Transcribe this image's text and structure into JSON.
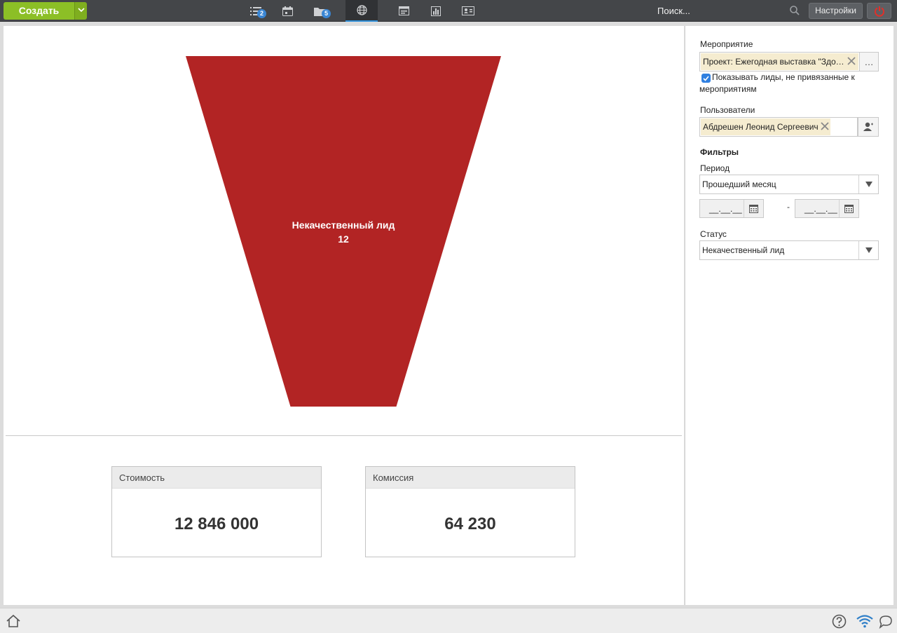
{
  "topbar": {
    "create_label": "Создать",
    "tasks_badge": "2",
    "files_badge": "5",
    "search_placeholder": "Поиск...",
    "settings_label": "Настройки"
  },
  "chart_data": {
    "type": "funnel",
    "stages": [
      {
        "label": "Некачественный лид",
        "value": 12,
        "color": "#b22424"
      }
    ]
  },
  "metrics": [
    {
      "title": "Стоимость",
      "value": "12 846 000"
    },
    {
      "title": "Комиссия",
      "value": "64 230"
    }
  ],
  "filters": {
    "event_label": "Мероприятие",
    "event_value": "Проект: Ежегодная выставка \"Здо…",
    "event_more": "…",
    "show_unlinked_label": "Показывать лиды, не привязанные к мероприятиям",
    "show_unlinked_checked": true,
    "users_label": "Пользователи",
    "users_value": "Абдрешен Леонид Сергеевич",
    "section_title": "Фильтры",
    "period_label": "Период",
    "period_value": "Прошедший месяц",
    "date_from": "__.__.__",
    "date_to": "__.__.__",
    "date_separator": "-",
    "status_label": "Статус",
    "status_value": "Некачественный лид"
  },
  "colors": {
    "accent": "#8cbf26",
    "funnel": "#b22424",
    "topbar": "#444649",
    "badge": "#3a86d4"
  }
}
